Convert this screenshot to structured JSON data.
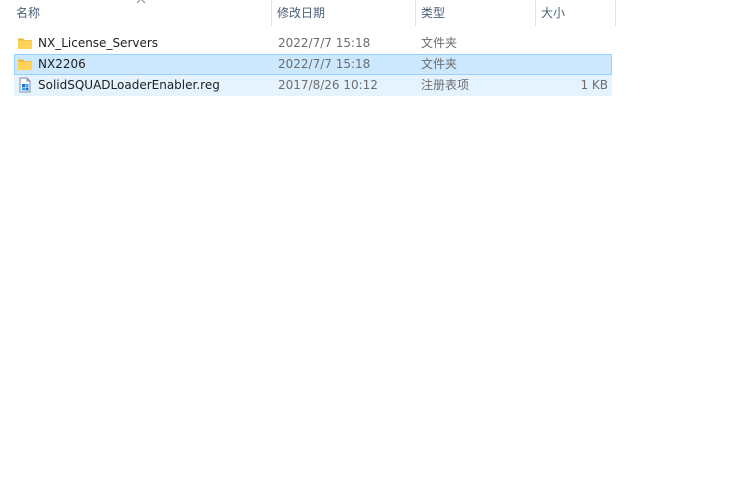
{
  "columns": {
    "name": "名称",
    "date": "修改日期",
    "type": "类型",
    "size": "大小"
  },
  "sort_indicator_icon": "sort-up-icon",
  "files": [
    {
      "name": "NX_License_Servers",
      "date": "2022/7/7 15:18",
      "type": "文件夹",
      "size": "",
      "icon": "folder-icon",
      "state": "normal"
    },
    {
      "name": "NX2206",
      "date": "2022/7/7 15:18",
      "type": "文件夹",
      "size": "",
      "icon": "folder-icon",
      "state": "selected"
    },
    {
      "name": "SolidSQUADLoaderEnabler.reg",
      "date": "2017/8/26 10:12",
      "type": "注册表项",
      "size": "1 KB",
      "icon": "registry-file-icon",
      "state": "hover"
    }
  ],
  "colors": {
    "selected_bg": "#cce8ff",
    "selected_border": "#99d1ff",
    "hover_bg": "#e5f3ff",
    "folder": "#ffd35a",
    "header_text": "#4c607a"
  }
}
